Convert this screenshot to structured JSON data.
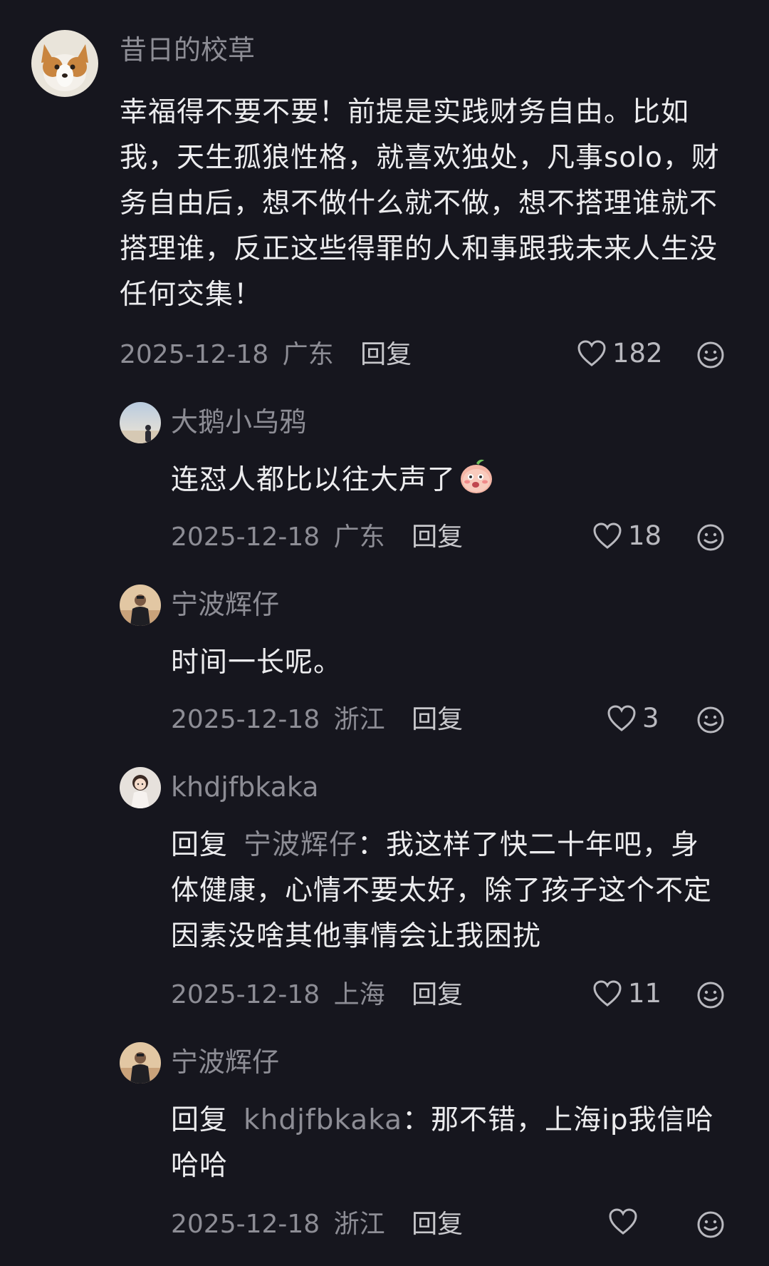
{
  "comments": [
    {
      "username": "昔日的校草",
      "content_lines": [
        "幸福得不要不要！前提是实践财务自由。比如",
        "我，天生孤狼性格，就喜欢独处，凡事solo，财",
        "务自由后，想不做什么就不做，想不搭理谁就不",
        "搭理谁，反正这些得罪的人和事跟我未来人生没",
        "任何交集！"
      ],
      "date": "2025-12-18",
      "location": "广东",
      "reply_label": "回复",
      "likes": "182",
      "avatar_icon": "corgi-avatar-icon"
    },
    {
      "username": "大鹅小乌鸦",
      "content": "连怼人都比以往大声了",
      "emoji": "peach-face-emoji",
      "date": "2025-12-18",
      "location": "广东",
      "reply_label": "回复",
      "likes": "18",
      "avatar_icon": "silhouette-avatar-icon"
    },
    {
      "username": "宁波辉仔",
      "content": "时间一长呢。",
      "date": "2025-12-18",
      "location": "浙江",
      "reply_label": "回复",
      "likes": "3",
      "avatar_icon": "man-avatar-icon"
    },
    {
      "username": "khdjfbkaka",
      "reply_prefix": "回复",
      "mention": "宁波辉仔",
      "content_first": "：我这样了快二十年吧，身",
      "content_lines": [
        "体健康，心情不要太好，除了孩子这个不定",
        "因素没啥其他事情会让我困扰"
      ],
      "date": "2025-12-18",
      "location": "上海",
      "reply_label": "回复",
      "likes": "11",
      "avatar_icon": "girl-avatar-icon"
    },
    {
      "username": "宁波辉仔",
      "reply_prefix": "回复",
      "mention": "khdjfbkaka",
      "content_first": "：那不错，上海ip我信哈",
      "content_lines": [
        "哈哈"
      ],
      "date": "2025-12-18",
      "location": "浙江",
      "reply_label": "回复",
      "likes": "",
      "avatar_icon": "man-avatar-icon"
    }
  ],
  "colors": {
    "background": "#16161e",
    "text": "#ececee",
    "muted": "#8d8d95"
  }
}
